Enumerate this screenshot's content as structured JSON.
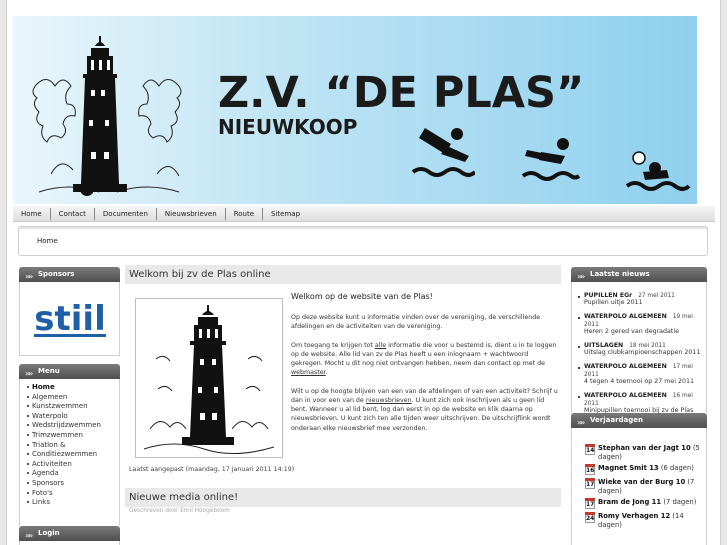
{
  "banner": {
    "title": "Z.V. “DE PLAS”",
    "subtitle": "NIEUWKOOP"
  },
  "topnav": [
    "Home",
    "Contact",
    "Documenten",
    "Nieuwsbrieven",
    "Route",
    "Sitemap"
  ],
  "breadcrumb": "Home",
  "sponsors": {
    "heading": "Sponsors",
    "logo_text": "stiil"
  },
  "menu": {
    "heading": "Menu",
    "items": [
      "Home",
      "Algemeen",
      "Kunstzwemmen",
      "Waterpolo",
      "Wedstrijdzwemmen",
      "Trimzwemmen",
      "Triatlon &",
      "Conditiezwemmen",
      "Activiteiten",
      "Agenda",
      "Sponsors",
      "Foto's",
      "Links"
    ]
  },
  "login": {
    "heading": "Login"
  },
  "article1": {
    "heading": "Welkom bij zv de Plas online",
    "lead": "Welkom op de website van de Plas!",
    "p1": "Op deze website kunt u informatie vinden over de vereniging, de verschillende afdelingen en de activiteiten van de vereniging.",
    "p2a": "Om toegang te krijgen tot ",
    "p2_link1": "alle",
    "p2b": " informatie die voor u bestemd is, dient u in te loggen op de website. Alle lid van zv de Plas heeft u een inlognaam + wachtwoord gekregen. Mocht u dit nog niet ontvangen hebben, neem dan contact op met de ",
    "p2_link2": "webmaster",
    "p2c": ".",
    "p3a": "Wilt u op de hoogte blijven van een van de afdelingen of van een activiteit? Schrijf u dan in voor een van de ",
    "p3_link": "nieuwsbrieven",
    "p3b": ". U kunt zich ook inschrijven als u geen lid bent. Wanneer u al lid bent, log dan eerst in op de website en klik daarna op nieuwsbrieven. U kunt zich ten alle tijden weer uitschrijven. De uitschrijflink wordt onderaan elke nieuwsbrief mee verzonden.",
    "modified": "Laatst aangepast (maandag, 17 januari 2011 14:19)"
  },
  "article2": {
    "heading": "Nieuwe media online!",
    "byline": "Geschreven door Emil Hoogeboom"
  },
  "news": {
    "heading": "Laatste nieuws",
    "items": [
      {
        "category": "PUPILLEN EGr",
        "date": "27 mei 2011",
        "title": "Pupillen uitje 2011"
      },
      {
        "category": "WATERPOLO ALGEMEEN",
        "date": "19 mei 2011",
        "title": "Heren 2 gered van degradatie"
      },
      {
        "category": "UITSLAGEN",
        "date": "18 mei 2011",
        "title": "Uitslag clubkampioenschappen 2011"
      },
      {
        "category": "WATERPOLO ALGEMEEN",
        "date": "17 mei 2011",
        "title": "4 tegen 4 toernooi op 27 mei 2011"
      },
      {
        "category": "WATERPOLO ALGEMEEN",
        "date": "16 mei 2011",
        "title": "Minipupillen toernooi bij zv de Plas"
      }
    ]
  },
  "birthdays": {
    "heading": "Verjaardagen",
    "items": [
      {
        "day": "14",
        "name": "Stephan van der Jagt 10",
        "when": "(5 dagen)"
      },
      {
        "day": "16",
        "name": "Magnet Smit 13",
        "when": "(6 dagen)"
      },
      {
        "day": "17",
        "name": "Wieke van der Burg 10",
        "when": "(7 dagen)"
      },
      {
        "day": "17",
        "name": "Bram de Jong 11",
        "when": "(7 dagen)"
      },
      {
        "day": "24",
        "name": "Romy Verhagen 12",
        "when": "(14 dagen)"
      }
    ]
  }
}
